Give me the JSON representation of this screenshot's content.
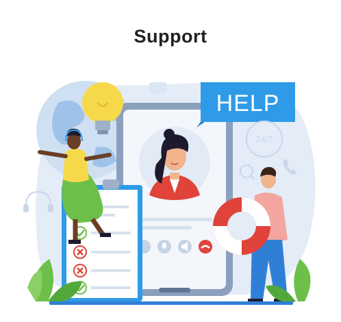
{
  "title": "Support",
  "help_sign": "HELP",
  "badge_247": "24/7",
  "colors": {
    "accent_blue": "#2f9be8",
    "background_blob": "#e4ecf7",
    "accent_red": "#e0433a",
    "bulb_yellow": "#f6d94a",
    "leaf_green": "#6cc04a"
  },
  "icons": [
    "lightbulb-icon",
    "headset-icon",
    "phone-icon",
    "chat-icon",
    "microphone-icon",
    "speaker-icon",
    "hang-up-icon",
    "checkmark-icon",
    "cross-icon"
  ]
}
